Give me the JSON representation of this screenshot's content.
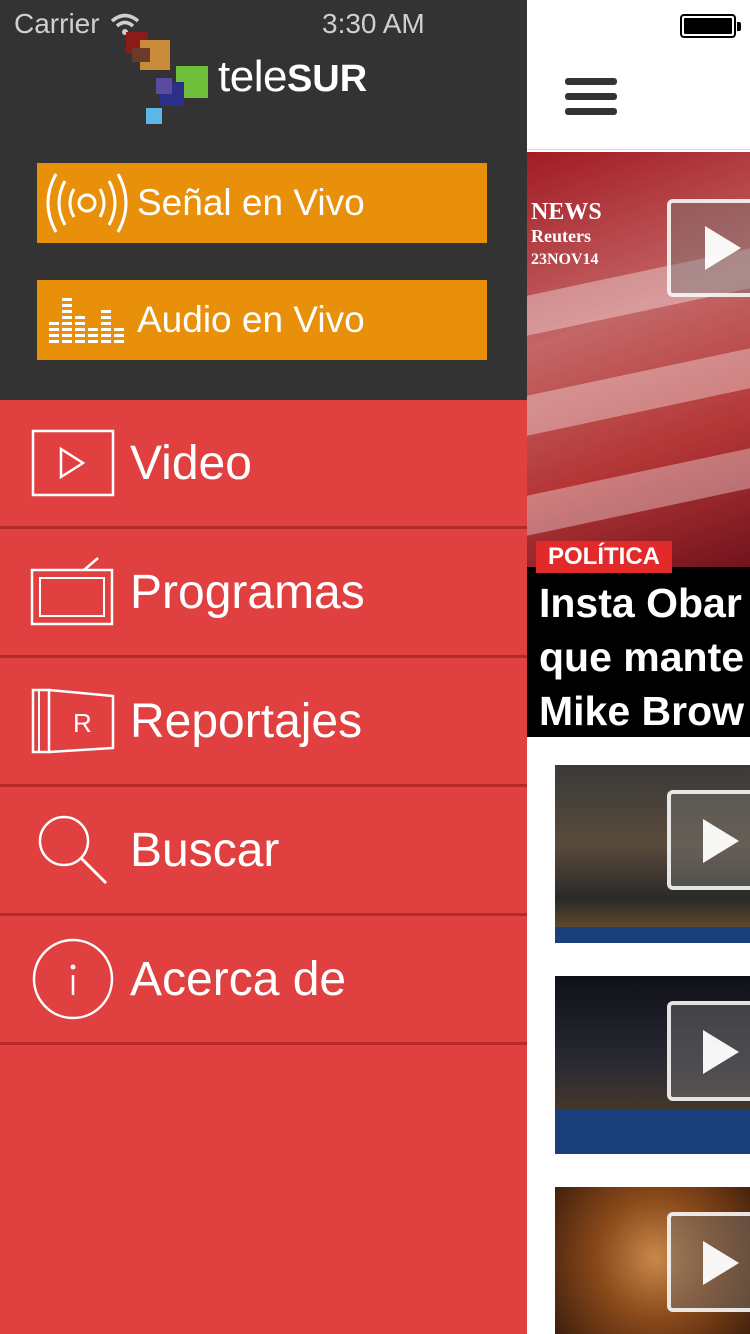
{
  "status_bar": {
    "carrier": "Carrier",
    "time": "3:30 AM",
    "icons": [
      "wifi-icon",
      "battery-icon"
    ]
  },
  "drawer": {
    "logo": {
      "text_light": "tele",
      "text_bold": "SUR"
    },
    "live_buttons": [
      {
        "label": "Señal en Vivo",
        "icon": "broadcast-icon"
      },
      {
        "label": "Audio en Vivo",
        "icon": "equalizer-icon"
      }
    ],
    "menu": [
      {
        "label": "Video",
        "icon": "video-play-icon"
      },
      {
        "label": "Programas",
        "icon": "tv-icon"
      },
      {
        "label": "Reportajes",
        "icon": "reportajes-icon"
      },
      {
        "label": "Buscar",
        "icon": "search-icon"
      },
      {
        "label": "Acerca de",
        "icon": "info-icon"
      }
    ]
  },
  "main": {
    "menu_icon": "hamburger-menu-icon",
    "hero": {
      "overlay_logo": "NEWS",
      "overlay_source": "Reuters",
      "overlay_date": "23NOV14",
      "category": "POLÍTICA",
      "title_lines": [
        "Insta Obar",
        "que mante",
        "Mike Brow"
      ]
    },
    "thumbnails": [
      {
        "icon": "play-icon"
      },
      {
        "icon": "play-icon"
      },
      {
        "icon": "play-icon"
      }
    ]
  },
  "colors": {
    "drawer_dark": "#333333",
    "drawer_red": "#e04040",
    "live_orange": "#e8900a",
    "badge_red": "#e22a2a"
  }
}
